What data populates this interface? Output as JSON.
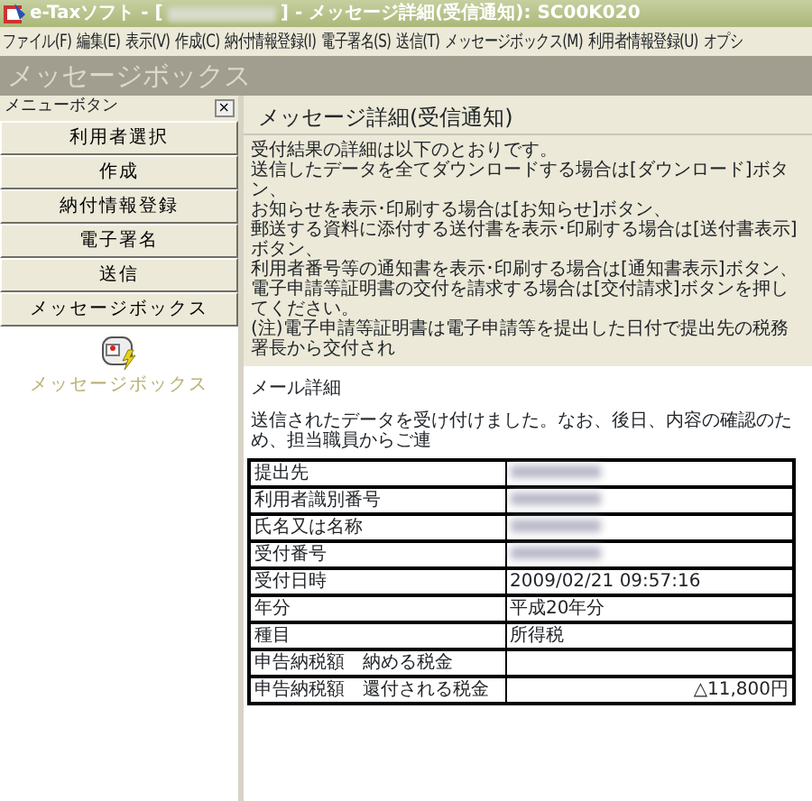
{
  "window": {
    "title_before": "e-Taxソフト - [",
    "title_after": "] - メッセージ詳細(受信通知): SC00K020"
  },
  "menu": [
    "ファイル(F)",
    "編集(E)",
    "表示(V)",
    "作成(C)",
    "納付情報登録(I)",
    "電子署名(S)",
    "送信(T)",
    "メッセージボックス(M)",
    "利用者情報登録(U)",
    "オプシ"
  ],
  "header": "メッセージボックス",
  "sidebar": {
    "title": "メニューボタン",
    "close": "×",
    "buttons": [
      "利用者選択",
      "作成",
      "納付情報登録",
      "電子署名",
      "送信",
      "メッセージボックス"
    ],
    "sub_item": "メッセージボックス"
  },
  "content": {
    "heading": "メッセージ詳細(受信通知)",
    "instructions": [
      "受付結果の詳細は以下のとおりです。",
      "送信したデータを全てダウンロードする場合は[ダウンロード]ボタン、",
      "お知らせを表示･印刷する場合は[お知らせ]ボタン、",
      "郵送する資料に添付する送付書を表示･印刷する場合は[送付書表示]ボタン、",
      "利用者番号等の通知書を表示･印刷する場合は[通知書表示]ボタン、",
      "電子申請等証明書の交付を請求する場合は[交付請求]ボタンを押してください。",
      "(注)電子申請等証明書は電子申請等を提出した日付で提出先の税務署長から交付され"
    ],
    "mail_heading": "メール詳細",
    "mail_text": "送信されたデータを受け付けました。なお、後日、内容の確認のため、担当職員からご連",
    "rows": [
      {
        "kind": "redacted",
        "label": "提出先"
      },
      {
        "kind": "redacted",
        "label": "利用者識別番号"
      },
      {
        "kind": "redacted",
        "label": "氏名又は名称"
      },
      {
        "kind": "redacted",
        "label": "受付番号"
      },
      {
        "kind": "text",
        "label": "受付日時",
        "value": "2009/02/21 09:57:16"
      },
      {
        "kind": "text",
        "label": "年分",
        "value": "平成20年分"
      },
      {
        "kind": "text",
        "label": "種目",
        "value": "所得税"
      },
      {
        "kind": "text",
        "label": "申告納税額　納める税金"
      },
      {
        "kind": "amount",
        "label": "申告納税額　還付される税金",
        "value": "△11,800円"
      }
    ]
  }
}
